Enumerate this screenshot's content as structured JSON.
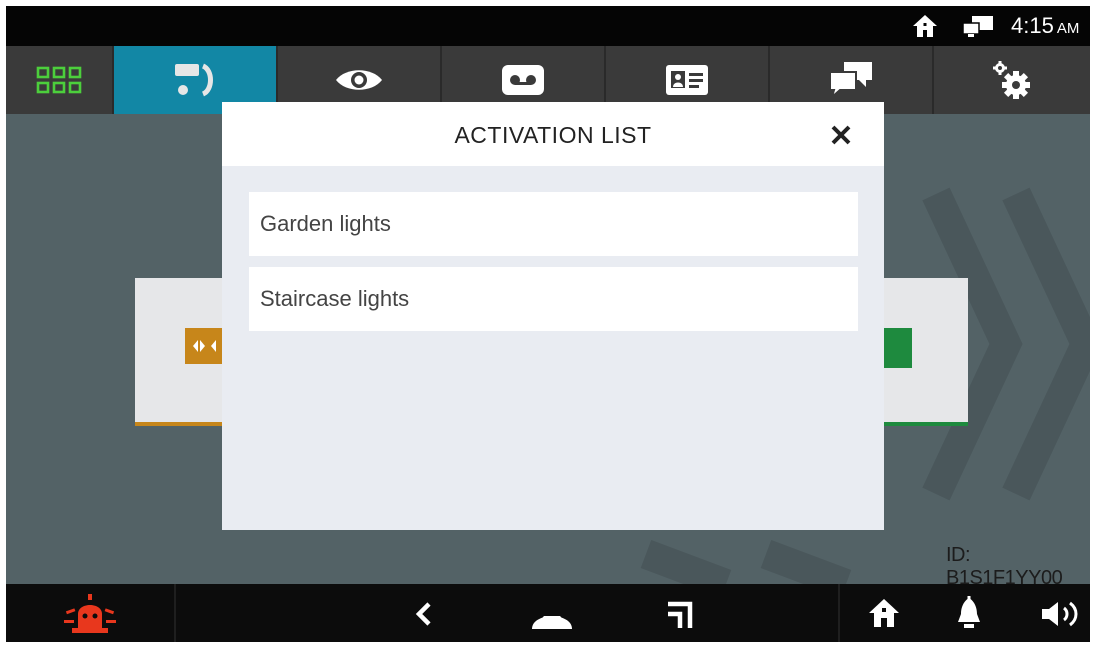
{
  "status_bar": {
    "time": "4:15",
    "ampm": "AM",
    "icons": [
      "home-icon",
      "monitor-icon"
    ]
  },
  "tabs": [
    {
      "name": "apps-grid",
      "icon": "grid-icon"
    },
    {
      "name": "intercom",
      "icon": "intercom-handset-icon",
      "active": true
    },
    {
      "name": "surveillance",
      "icon": "eye-icon"
    },
    {
      "name": "voicemail",
      "icon": "voicemail-icon"
    },
    {
      "name": "contacts",
      "icon": "id-card-icon"
    },
    {
      "name": "messages",
      "icon": "chat-icon"
    },
    {
      "name": "settings",
      "icon": "gears-icon"
    }
  ],
  "main": {
    "device_id": "ID: B1S1F1YY00"
  },
  "dialog": {
    "title": "ACTIVATION LIST",
    "close_icon": "close-icon",
    "items": [
      {
        "label": "Garden lights"
      },
      {
        "label": "Staircase lights"
      }
    ]
  },
  "nav_bar": {
    "icons": [
      "alarm-icon",
      "back-icon",
      "home-dome-icon",
      "recent-icon",
      "home-icon",
      "bell-icon",
      "volume-icon"
    ]
  },
  "colors": {
    "accent": "#1287a5",
    "alarm": "#e8371d",
    "card_orange": "#c7861a",
    "card_green": "#1e8a3e",
    "background": "#536266"
  }
}
